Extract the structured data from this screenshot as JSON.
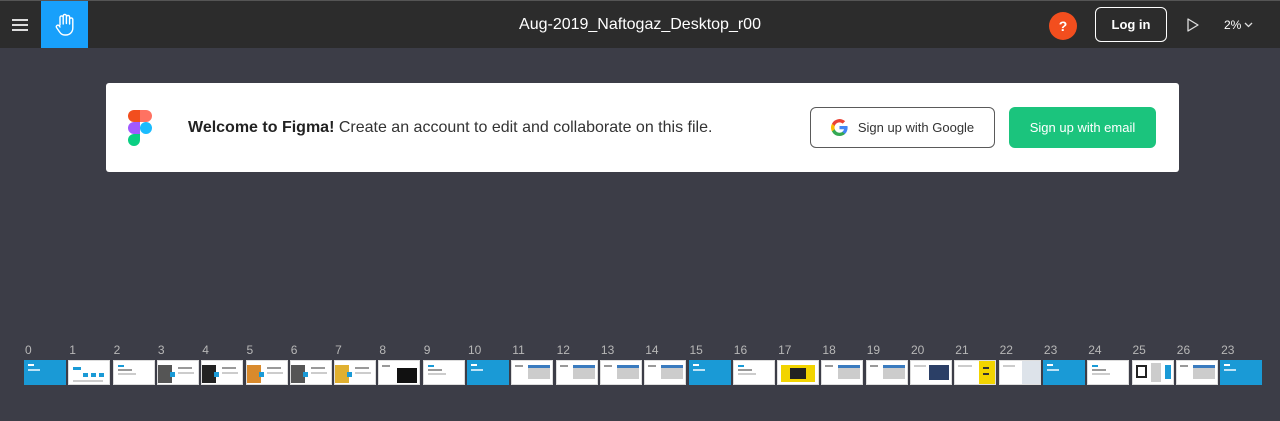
{
  "header": {
    "title": "Aug-2019_Naftogaz_Desktop_r00",
    "help_label": "?",
    "login_label": "Log in",
    "zoom": "2%",
    "icons": {
      "menu": "hamburger-icon",
      "hand": "hand-icon",
      "play": "play-icon",
      "chevron": "chevron-down-icon"
    },
    "colors": {
      "bar": "#2c2c2c",
      "hand_bg": "#18a0fb",
      "help_bg": "#f24e1e"
    }
  },
  "banner": {
    "welcome_bold": "Welcome to Figma!",
    "welcome_rest": " Create an account to edit and collaborate on this file.",
    "google_label": "Sign up with Google",
    "email_label": "Sign up with email",
    "colors": {
      "email_bg": "#1bc47d"
    }
  },
  "frames": [
    {
      "label": "0",
      "style": "blue"
    },
    {
      "label": "1",
      "style": "grid"
    },
    {
      "label": "2",
      "style": "text"
    },
    {
      "label": "3",
      "style": "photo"
    },
    {
      "label": "4",
      "style": "photo-dark"
    },
    {
      "label": "5",
      "style": "photo-orange"
    },
    {
      "label": "6",
      "style": "photo"
    },
    {
      "label": "7",
      "style": "photo-yellow"
    },
    {
      "label": "8",
      "style": "dark-block"
    },
    {
      "label": "9",
      "style": "text"
    },
    {
      "label": "10",
      "style": "blue"
    },
    {
      "label": "11",
      "style": "screen"
    },
    {
      "label": "12",
      "style": "screen"
    },
    {
      "label": "13",
      "style": "screen"
    },
    {
      "label": "14",
      "style": "screen"
    },
    {
      "label": "15",
      "style": "blue"
    },
    {
      "label": "16",
      "style": "text"
    },
    {
      "label": "17",
      "style": "yellow-device"
    },
    {
      "label": "18",
      "style": "screen"
    },
    {
      "label": "19",
      "style": "screen"
    },
    {
      "label": "20",
      "style": "dark-image"
    },
    {
      "label": "21",
      "style": "yellow-list"
    },
    {
      "label": "22",
      "style": "gray-panel"
    },
    {
      "label": "23",
      "style": "blue"
    },
    {
      "label": "24",
      "style": "text"
    },
    {
      "label": "25",
      "style": "qr-phone"
    },
    {
      "label": "26",
      "style": "screen"
    },
    {
      "label": "23",
      "style": "blue"
    }
  ]
}
